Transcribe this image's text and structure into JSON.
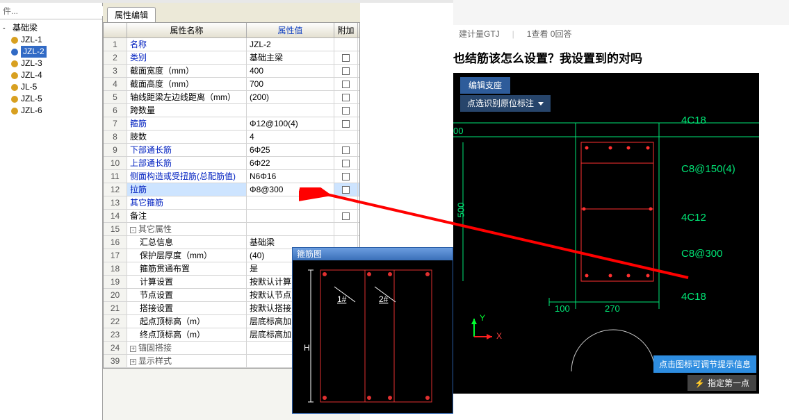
{
  "tree": {
    "search_placeholder": "件...",
    "root": "基础梁",
    "items": [
      "JZL-1",
      "JZL-2",
      "JZL-3",
      "JZL-4",
      "JL-5",
      "JZL-5",
      "JZL-6"
    ],
    "selected": "JZL-2"
  },
  "prop": {
    "tab": "属性编辑",
    "header_name": "属性名称",
    "header_value": "属性值",
    "header_add": "附加",
    "rows": [
      {
        "idx": "1",
        "name": "名称",
        "val": "JZL-2",
        "chk": false,
        "link": true
      },
      {
        "idx": "2",
        "name": "类别",
        "val": "基础主梁",
        "chk": true,
        "link": true
      },
      {
        "idx": "3",
        "name": "截面宽度（mm）",
        "val": "400",
        "chk": true
      },
      {
        "idx": "4",
        "name": "截面高度（mm）",
        "val": "700",
        "chk": true
      },
      {
        "idx": "5",
        "name": "轴线距梁左边线距离（mm）",
        "val": "(200)",
        "chk": true
      },
      {
        "idx": "6",
        "name": "跨数量",
        "val": "",
        "chk": true
      },
      {
        "idx": "7",
        "name": "箍筋",
        "val": "Φ12@100(4)",
        "chk": true,
        "link": true
      },
      {
        "idx": "8",
        "name": "肢数",
        "val": "4",
        "chk": false
      },
      {
        "idx": "9",
        "name": "下部通长筋",
        "val": "6Φ25",
        "chk": true,
        "link": true
      },
      {
        "idx": "10",
        "name": "上部通长筋",
        "val": "6Φ22",
        "chk": true,
        "link": true
      },
      {
        "idx": "11",
        "name": "侧面构造或受扭筋(总配筋值)",
        "val": "N6Φ16",
        "chk": true,
        "link": true
      },
      {
        "idx": "12",
        "name": "拉筋",
        "val": "Φ8@300",
        "chk": true,
        "link": true,
        "hl": true
      },
      {
        "idx": "13",
        "name": "其它箍筋",
        "val": "",
        "chk": false,
        "link": true
      },
      {
        "idx": "14",
        "name": "备注",
        "val": "",
        "chk": true
      },
      {
        "idx": "15",
        "name": "其它属性",
        "val": "",
        "group": true,
        "expanded": true
      },
      {
        "idx": "16",
        "name": "汇总信息",
        "val": "基础梁",
        "indent": true
      },
      {
        "idx": "17",
        "name": "保护层厚度（mm）",
        "val": "(40)",
        "indent": true
      },
      {
        "idx": "18",
        "name": "箍筋贯通布置",
        "val": "是",
        "indent": true
      },
      {
        "idx": "19",
        "name": "计算设置",
        "val": "按默认计算",
        "indent": true
      },
      {
        "idx": "20",
        "name": "节点设置",
        "val": "按默认节点",
        "indent": true
      },
      {
        "idx": "21",
        "name": "搭接设置",
        "val": "按默认搭接",
        "indent": true
      },
      {
        "idx": "22",
        "name": "起点顶标高（m）",
        "val": "层底标高加",
        "indent": true
      },
      {
        "idx": "23",
        "name": "终点顶标高（m）",
        "val": "层底标高加",
        "indent": true
      },
      {
        "idx": "24",
        "name": "锚固搭接",
        "val": "",
        "group": true,
        "expanded": false
      },
      {
        "idx": "39",
        "name": "显示样式",
        "val": "",
        "group": true,
        "expanded": false
      }
    ]
  },
  "stirrup": {
    "title": "箍筋图",
    "label1": "1#",
    "label2": "2#",
    "H": "H"
  },
  "right": {
    "crumb1": "建计量GTJ",
    "crumb2": "1查看  0回答",
    "title": "也结筋该怎么设置？我设置到的对吗",
    "btn1": "编辑支座",
    "btn2": "点选识别原位标注",
    "hint": "点击图标可调节提示信息",
    "foot": "指定第一点",
    "anno_top": "4C18",
    "anno_c8150": "C8@150(4)",
    "anno_4c12": "4C12",
    "anno_c8300": "C8@300",
    "anno_bot": "4C18",
    "dim100": "100",
    "dim270": "270",
    "dim500": "500",
    "dim600": "00",
    "X": "X",
    "Y": "Y"
  }
}
